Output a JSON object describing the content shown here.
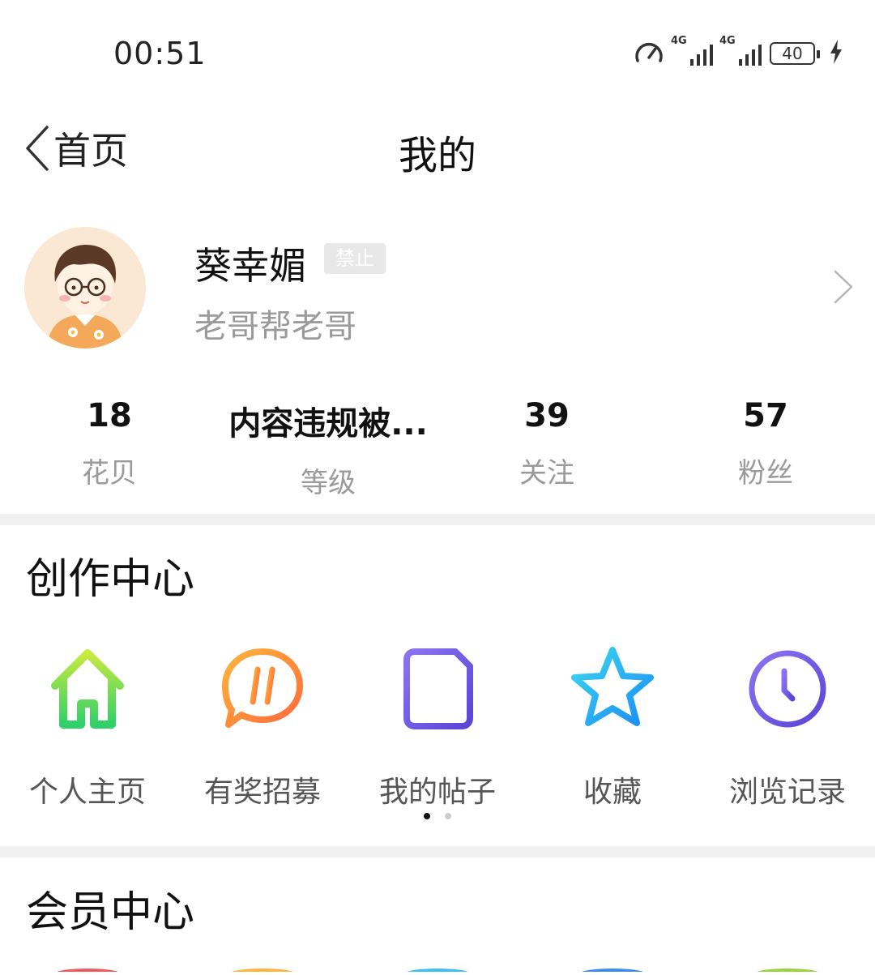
{
  "status_bar": {
    "time": "00:51",
    "battery": "40",
    "network_a": "4G",
    "network_b": "4G"
  },
  "nav": {
    "back_label": "首页",
    "title": "我的"
  },
  "profile": {
    "name": "葵幸媚",
    "badge": "禁止",
    "signature": "老哥帮老哥"
  },
  "stats": [
    {
      "value": "18",
      "label": "花贝"
    },
    {
      "value": "内容违规被...",
      "label": "等级"
    },
    {
      "value": "39",
      "label": "关注"
    },
    {
      "value": "57",
      "label": "粉丝"
    }
  ],
  "creation_center": {
    "title": "创作中心",
    "items": [
      {
        "label": "个人主页",
        "icon": "home-icon"
      },
      {
        "label": "有奖招募",
        "icon": "hashtag-chat-icon"
      },
      {
        "label": "我的帖子",
        "icon": "document-icon"
      },
      {
        "label": "收藏",
        "icon": "star-icon"
      },
      {
        "label": "浏览记录",
        "icon": "clock-icon"
      }
    ],
    "page_count": 2,
    "current_page": 1
  },
  "member_center": {
    "title": "会员中心"
  }
}
